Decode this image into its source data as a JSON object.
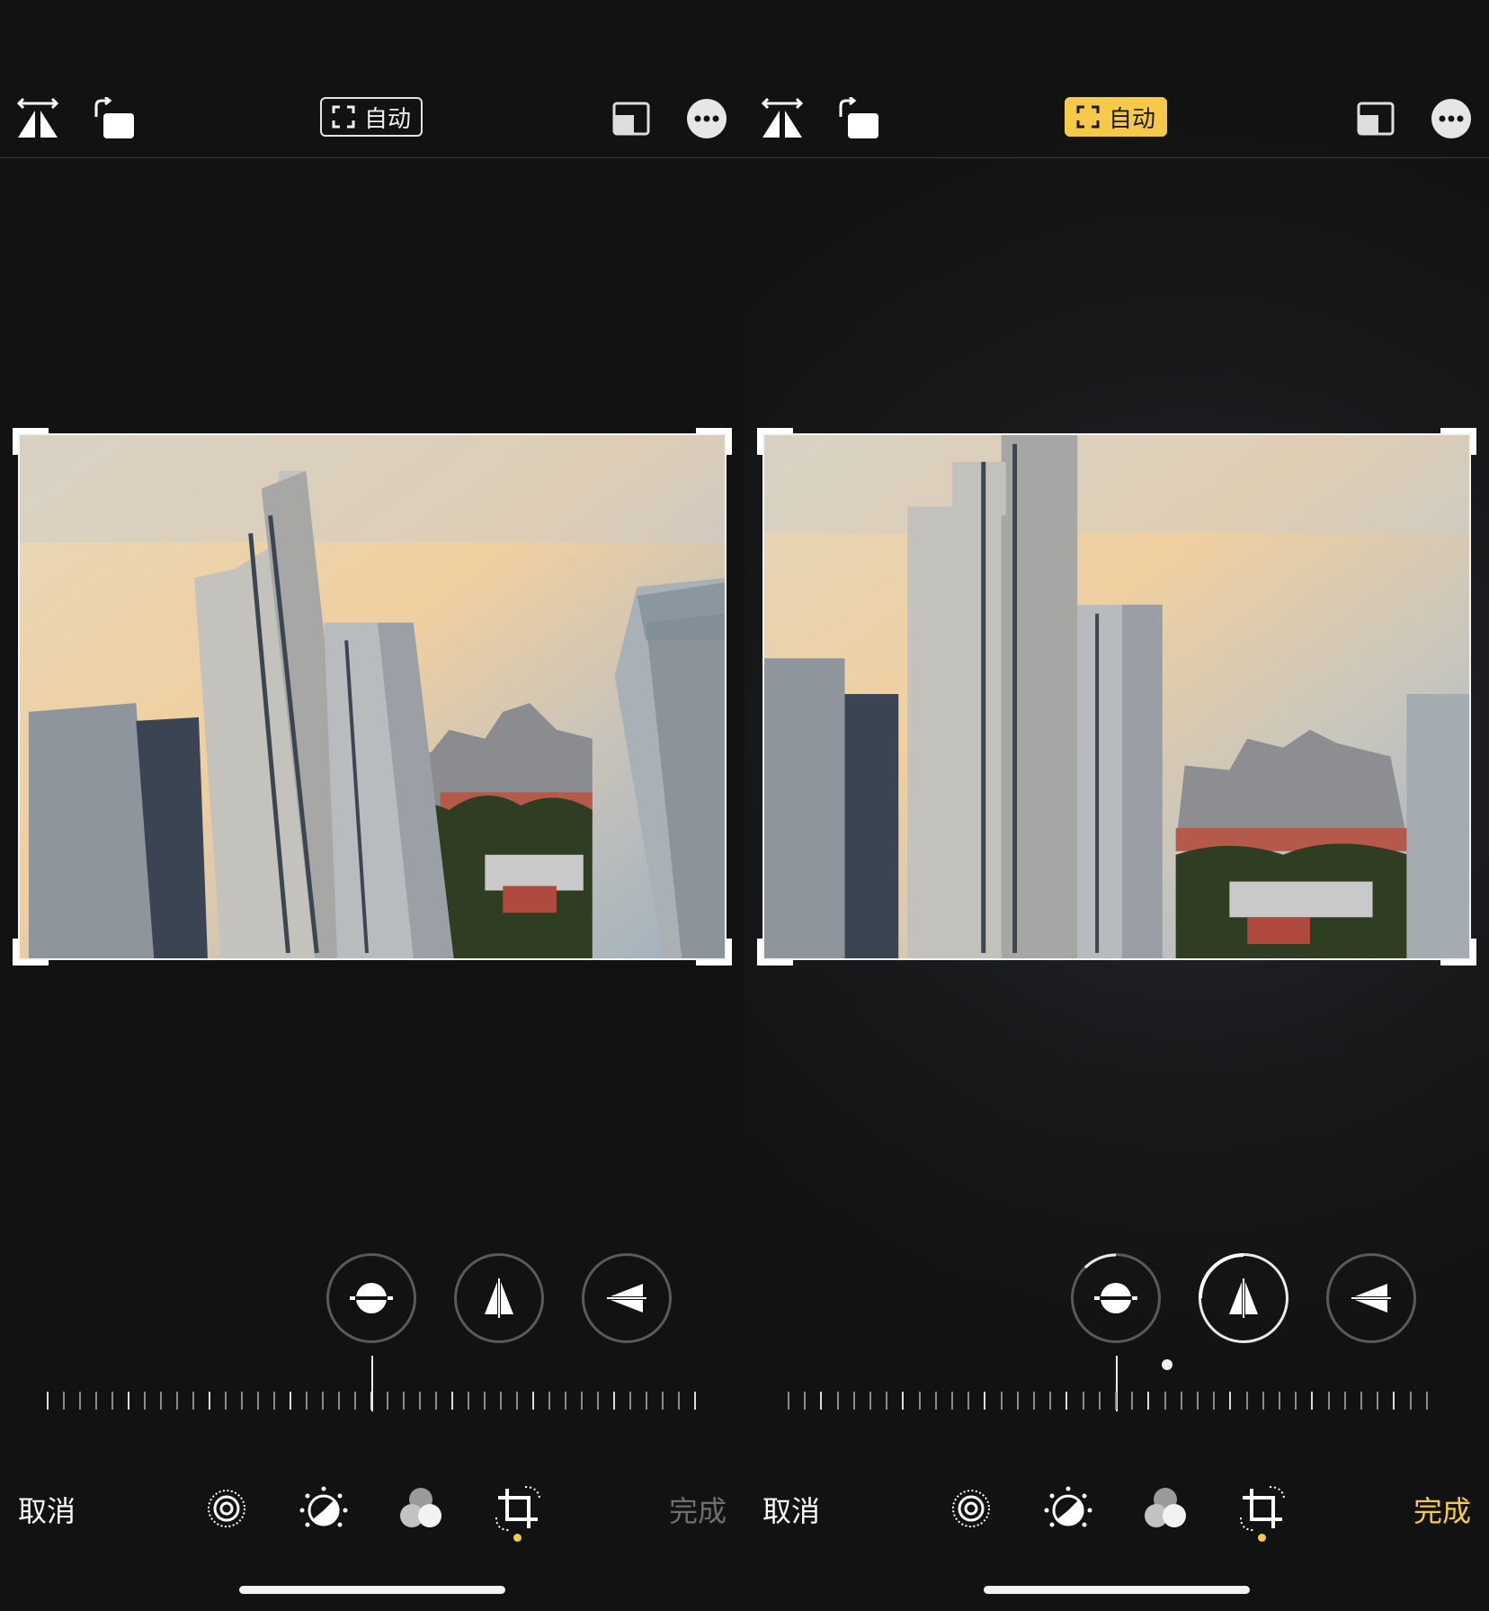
{
  "panels": [
    {
      "id": "before",
      "auto_label": "自动",
      "auto_active": false,
      "cancel_label": "取消",
      "done_label": "完成",
      "done_active": false,
      "slider_value": 0,
      "icons": {
        "flip": "flip-horizontal-icon",
        "rotate": "rotate-icon",
        "aspect": "aspect-ratio-icon",
        "more": "more-icon",
        "auto": "auto-straighten-icon",
        "straighten": "straighten-icon",
        "vertical": "vertical-perspective-icon",
        "horizontal": "horizontal-perspective-icon",
        "live": "live-photo-icon",
        "adjust": "adjust-icon",
        "filters": "filters-icon",
        "crop": "crop-icon"
      }
    },
    {
      "id": "after",
      "auto_label": "自动",
      "auto_active": true,
      "cancel_label": "取消",
      "done_label": "完成",
      "done_active": true,
      "slider_value": 0,
      "icons": {
        "flip": "flip-horizontal-icon",
        "rotate": "rotate-icon",
        "aspect": "aspect-ratio-icon",
        "more": "more-icon",
        "auto": "auto-straighten-icon",
        "straighten": "straighten-icon",
        "vertical": "vertical-perspective-icon",
        "horizontal": "horizontal-perspective-icon",
        "live": "live-photo-icon",
        "adjust": "adjust-icon",
        "filters": "filters-icon",
        "crop": "crop-icon"
      }
    }
  ],
  "colors": {
    "accent": "#f7c948",
    "background": "#121212",
    "inactive_text": "#6e6e6e"
  }
}
